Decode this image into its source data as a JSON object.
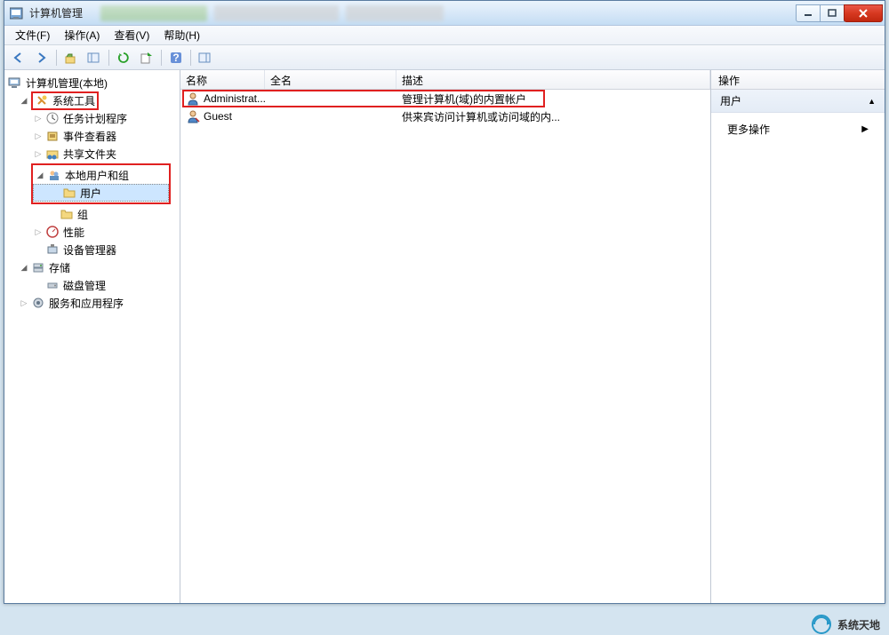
{
  "window": {
    "title": "计算机管理"
  },
  "menubar": {
    "file": "文件(F)",
    "action": "操作(A)",
    "view": "查看(V)",
    "help": "帮助(H)"
  },
  "tree": {
    "root": "计算机管理(本地)",
    "system_tools": "系统工具",
    "task_scheduler": "任务计划程序",
    "event_viewer": "事件查看器",
    "shared_folders": "共享文件夹",
    "local_users_groups": "本地用户和组",
    "users": "用户",
    "groups": "组",
    "performance": "性能",
    "device_manager": "设备管理器",
    "storage": "存储",
    "disk_management": "磁盘管理",
    "services_apps": "服务和应用程序"
  },
  "list": {
    "columns": {
      "name": "名称",
      "fullname": "全名",
      "desc": "描述"
    },
    "rows": [
      {
        "name": "Administrat...",
        "fullname": "",
        "desc": "管理计算机(域)的内置帐户"
      },
      {
        "name": "Guest",
        "fullname": "",
        "desc": "供来宾访问计算机或访问域的内..."
      }
    ]
  },
  "actions": {
    "header": "操作",
    "section": "用户",
    "more": "更多操作"
  },
  "watermark": "系统天地"
}
